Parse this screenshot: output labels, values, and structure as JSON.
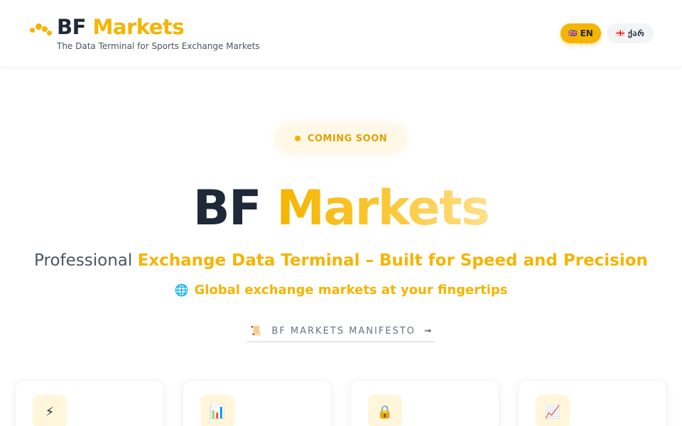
{
  "header": {
    "brand_part1": "BF",
    "brand_part2": "Markets",
    "tagline": "The Data Terminal for Sports Exchange Markets",
    "lang_en": {
      "flag": "🇬🇧",
      "label": "EN",
      "active": true
    },
    "lang_ka": {
      "flag": "🇬🇪",
      "label": "ქარ",
      "active": false
    }
  },
  "hero": {
    "badge": "COMING SOON",
    "title_part1": "BF",
    "title_part2": "Markets",
    "subtitle_part1": "Professional",
    "subtitle_part2": "Exchange Data Terminal – Built for Speed and Precision",
    "tagline_icon": "🌐",
    "tagline": "Global exchange markets at your fingertips",
    "manifesto_icon": "📜",
    "manifesto_label": "BF MARKETS MANIFESTO",
    "manifesto_arrow": "➟"
  },
  "features": [
    {
      "icon": "⚡",
      "icon_name": "lightning-icon"
    },
    {
      "icon": "📊",
      "icon_name": "chart-icon"
    },
    {
      "icon": "🔒",
      "icon_name": "lock-icon"
    },
    {
      "icon": "📈",
      "icon_name": "trend-icon"
    }
  ],
  "colors": {
    "accent": "#f5b400",
    "dark": "#1f2937",
    "muted": "#4b5563"
  }
}
